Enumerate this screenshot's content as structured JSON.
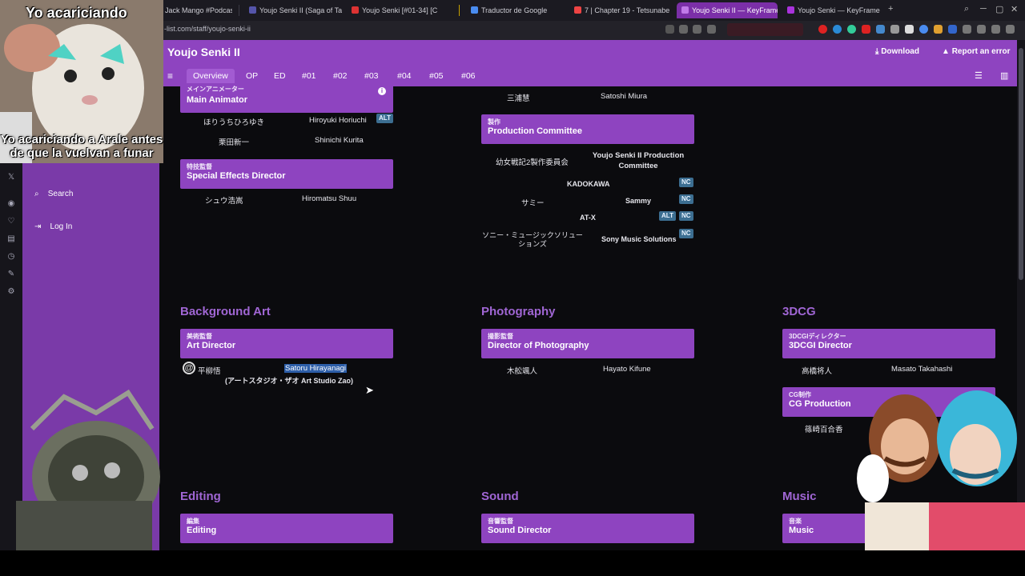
{
  "browser": {
    "tabs": [
      {
        "label": "Jack Mango #Podcast",
        "color": "#d33"
      },
      {
        "label": "Youjo Senki II (Saga of Tan",
        "color": "#55a"
      },
      {
        "label": "Youjo Senki [#01-34] [C",
        "color": "#d33"
      },
      {
        "label": "Traductor de Google",
        "color": "#4a8cf0"
      },
      {
        "label": "7 | Chapter 19 - Tetsunabe",
        "color": "#e44"
      },
      {
        "label": "Youjo Senki II — KeyFrame",
        "color": "#a3d"
      },
      {
        "label": "Youjo Senki — KeyFrame S",
        "color": "#a3d"
      }
    ],
    "url": "-list.com/staff/youjo-senki-ii"
  },
  "overlay": {
    "top_caption": "Yo acariciando",
    "bottom_caption": "Yo acariciando a Arale antes de que la vuelvan a funar"
  },
  "header": {
    "title": "Youjo Senki II",
    "download": "Download",
    "report": "Report an error",
    "tabs": [
      "Overview",
      "OP",
      "ED",
      "#01",
      "#02",
      "#03",
      "#04",
      "#05",
      "#06"
    ]
  },
  "sidebar": {
    "search": "Search",
    "login": "Log In"
  },
  "sections": {
    "main_animator": {
      "jp": "メインアニメーター",
      "en": "Main Animator",
      "rows": [
        {
          "jp": "ほりうちひろゆき",
          "en": "Hiroyuki Horiuchi",
          "badge": "ALT"
        },
        {
          "jp": "栗田新一",
          "en": "Shinichi Kurita"
        }
      ]
    },
    "sfx": {
      "jp": "特技監督",
      "en": "Special Effects Director",
      "rows": [
        {
          "jp": "シュウ浩嵩",
          "en": "Hiromatsu Shuu"
        }
      ]
    },
    "top_mid_row": {
      "jp": "三浦慧",
      "en": "Satoshi Miura"
    },
    "production": {
      "jp": "製作",
      "en": "Production Committee",
      "rows": [
        {
          "jp": "幼女戦記2製作委員会",
          "en": "Youjo Senki II Production Committee"
        },
        {
          "jp": "KADOKAWA",
          "badge": "NC"
        },
        {
          "jp": "サミー",
          "en": "Sammy",
          "badge": "NC"
        },
        {
          "jp": "AT-X",
          "badge1": "ALT",
          "badge2": "NC"
        },
        {
          "jp": "ソニー・ミュージックソリューションズ",
          "en": "Sony Music Solutions",
          "badge": "NC"
        }
      ]
    },
    "background_art": {
      "title": "Background Art",
      "jp": "美術監督",
      "en": "Art Director",
      "row": {
        "jp": "平柳悟",
        "en": "Satoru Hirayanagi",
        "studio": "(アートスタジオ・ザオ Art Studio Zao)"
      }
    },
    "photography": {
      "title": "Photography",
      "jp": "撮影監督",
      "en": "Director of Photography",
      "row": {
        "jp": "木舩颯人",
        "en": "Hayato Kifune"
      }
    },
    "cg": {
      "title": "3DCG",
      "jp": "3DCGIディレクター",
      "en": "3DCGI Director",
      "row": {
        "jp": "高橋将人",
        "en": "Masato Takahashi"
      },
      "prod_jp": "CG制作",
      "prod_en": "CG Production",
      "prod_row": "篠崎百合香"
    },
    "editing": {
      "title": "Editing",
      "jp": "編集",
      "en": "Editing"
    },
    "sound": {
      "title": "Sound",
      "jp": "音響監督",
      "en": "Sound Director"
    },
    "music": {
      "title": "Music",
      "jp": "音楽",
      "en": "Music"
    }
  }
}
